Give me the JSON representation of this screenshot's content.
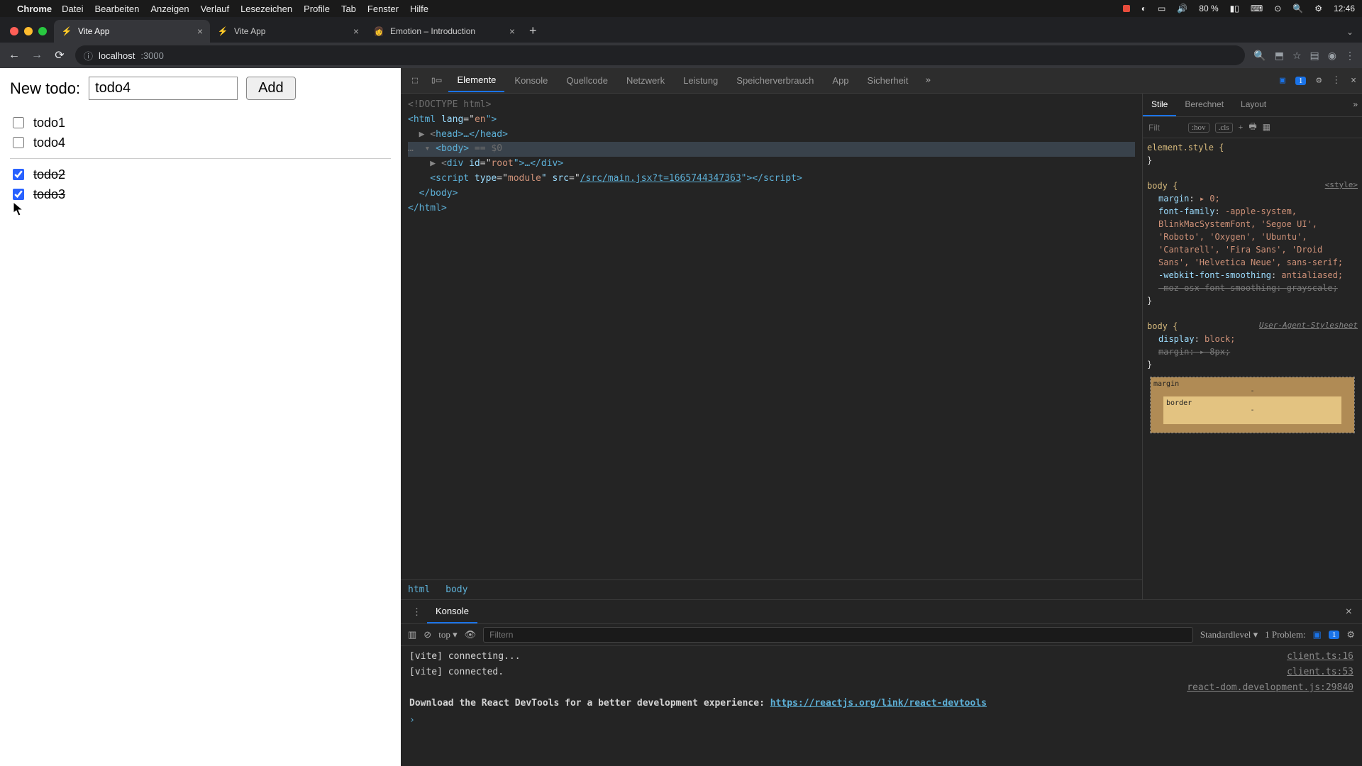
{
  "menubar": {
    "app": "Chrome",
    "menus": [
      "Datei",
      "Bearbeiten",
      "Anzeigen",
      "Verlauf",
      "Lesezeichen",
      "Profile",
      "Tab",
      "Fenster",
      "Hilfe"
    ],
    "battery": "80 %",
    "time": "12:46"
  },
  "tabs": [
    {
      "title": "Vite App",
      "favicon": "⚡",
      "active": true
    },
    {
      "title": "Vite App",
      "favicon": "⚡",
      "active": false
    },
    {
      "title": "Emotion – Introduction",
      "favicon": "👩",
      "active": false
    }
  ],
  "addressbar": {
    "host": "localhost",
    "port": ":3000"
  },
  "todo": {
    "label": "New todo:",
    "input_value": "todo4",
    "add_label": "Add",
    "open": [
      {
        "label": "todo1",
        "checked": false
      },
      {
        "label": "todo4",
        "checked": false
      }
    ],
    "done": [
      {
        "label": "todo2",
        "checked": true
      },
      {
        "label": "todo3",
        "checked": true
      }
    ]
  },
  "devtools": {
    "tabs": [
      "Elemente",
      "Konsole",
      "Quellcode",
      "Netzwerk",
      "Leistung",
      "Speicherverbrauch",
      "App",
      "Sicherheit"
    ],
    "active_tab": "Elemente",
    "issues_count": "1",
    "dom": {
      "l1": "<!DOCTYPE html>",
      "l2a": "<",
      "l2b": "html",
      "l2c": " lang",
      "l2d": "=\"",
      "l2e": "en",
      "l2f": "\">",
      "l3a": "  ▶ <",
      "l3b": "head",
      "l3c": ">…</",
      "l3d": "head",
      "l3e": ">",
      "l4pre": "…  ▾ ",
      "l4a": "<",
      "l4b": "body",
      "l4c": ">",
      "l4eq": " == $0",
      "l5a": "    ▶ <",
      "l5b": "div",
      "l5c": " id",
      "l5d": "=\"",
      "l5e": "root",
      "l5f": "\">…</",
      "l5g": "div",
      "l5h": ">",
      "l6a": "    <",
      "l6b": "script",
      "l6c": " type",
      "l6d": "=\"",
      "l6e": "module",
      "l6f": "\" src",
      "l6g": "=\"",
      "l6h": "/src/main.jsx?t=1665744347363",
      "l6i": "\"></",
      "l6j": "script",
      "l6k": ">",
      "l7a": "  </",
      "l7b": "body",
      "l7c": ">",
      "l8a": "</",
      "l8b": "html",
      "l8c": ">"
    },
    "breadcrumb": [
      "html",
      "body"
    ],
    "styles": {
      "tabs": [
        "Stile",
        "Berechnet",
        "Layout"
      ],
      "active": "Stile",
      "filter_placeholder": "Filt",
      "hov": ":hov",
      "cls": ".cls",
      "element_style": "element.style {",
      "close_brace": "}",
      "rule1_sel": "body {",
      "rule1_src": "<style>",
      "rule1_props": [
        {
          "p": "margin",
          "v": "▸ 0;",
          "strike": false
        },
        {
          "p": "font-family",
          "v": "-apple-system, BlinkMacSystemFont, 'Segoe UI', 'Roboto', 'Oxygen', 'Ubuntu', 'Cantarell', 'Fira Sans', 'Droid Sans', 'Helvetica Neue', sans-serif;",
          "strike": false
        },
        {
          "p": "-webkit-font-smoothing",
          "v": "antialiased;",
          "strike": false
        },
        {
          "p": "-moz-osx-font-smoothing",
          "v": "grayscale;",
          "strike": true
        }
      ],
      "rule2_sel": "body {",
      "rule2_note": "User-Agent-Stylesheet",
      "rule2_props": [
        {
          "p": "display",
          "v": "block;",
          "strike": false
        },
        {
          "p": "margin",
          "v": "▸ 8px;",
          "strike": true
        }
      ],
      "boxmodel": {
        "margin": "margin",
        "border": "border",
        "dash": "-"
      }
    },
    "drawer": {
      "title": "Konsole",
      "context": "top",
      "filter_placeholder": "Filtern",
      "level": "Standardlevel",
      "problems_label": "1 Problem:",
      "problems_count": "1",
      "lines": [
        {
          "msg": "[vite] connecting...",
          "src": "client.ts:16",
          "bold": false
        },
        {
          "msg": "[vite] connected.",
          "src": "client.ts:53",
          "bold": false
        },
        {
          "msg": "",
          "src": "react-dom.development.js:29840",
          "bold": false
        },
        {
          "msg": "Download the React DevTools for a better development experience: ",
          "link": "https://reactjs.org/link/react-devtools",
          "src": "",
          "bold": true
        }
      ]
    }
  }
}
